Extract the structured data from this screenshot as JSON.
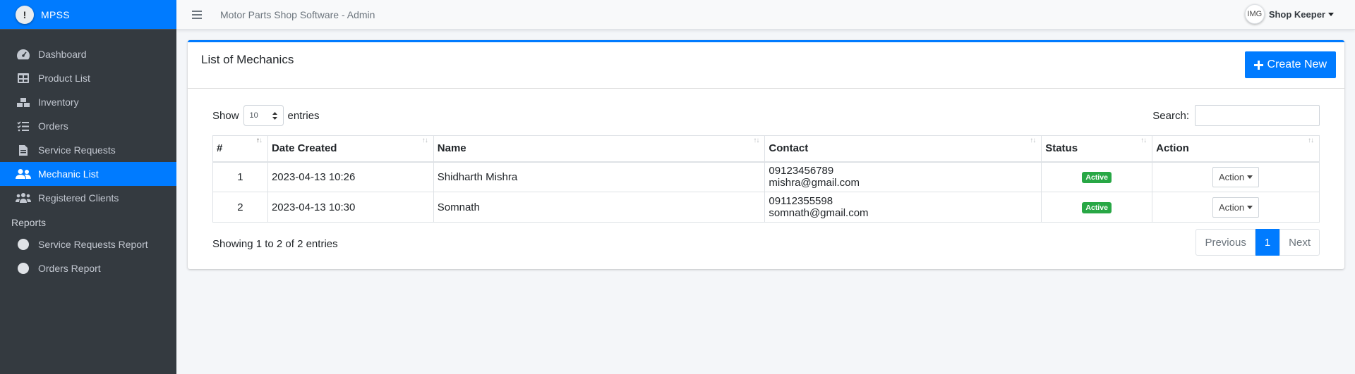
{
  "brand": {
    "logo_text": "!",
    "name": "MPSS"
  },
  "topbar": {
    "title": "Motor Parts Shop Software - Admin",
    "user": "Shop Keeper",
    "avatar_text": "IMG"
  },
  "sidebar": {
    "items": [
      {
        "label": "Dashboard",
        "icon": "tachometer-icon"
      },
      {
        "label": "Product List",
        "icon": "table-grid-icon"
      },
      {
        "label": "Inventory",
        "icon": "boxes-icon"
      },
      {
        "label": "Orders",
        "icon": "list-check-icon"
      },
      {
        "label": "Service Requests",
        "icon": "file-icon"
      },
      {
        "label": "Mechanic List",
        "icon": "user-friends-icon",
        "active": true
      },
      {
        "label": "Registered Clients",
        "icon": "users-icon"
      }
    ],
    "reports_header": "Reports",
    "reports": [
      {
        "label": "Service Requests Report",
        "icon": "circle-icon"
      },
      {
        "label": "Orders Report",
        "icon": "circle-icon"
      }
    ]
  },
  "card": {
    "title": "List of Mechanics",
    "create_label": "Create New",
    "show_label": "Show",
    "entries_value": "10",
    "entries_label": "entries",
    "search_label": "Search:"
  },
  "table": {
    "columns": [
      "#",
      "Date Created",
      "Name",
      "Contact",
      "Status",
      "Action"
    ],
    "rows": [
      {
        "num": "1",
        "date": "2023-04-13 10:26",
        "name": "Shidharth Mishra",
        "phone": "09123456789",
        "email": "mishra@gmail.com",
        "status": "Active",
        "action": "Action"
      },
      {
        "num": "2",
        "date": "2023-04-13 10:30",
        "name": "Somnath",
        "phone": "09112355598",
        "email": "somnath@gmail.com",
        "status": "Active",
        "action": "Action"
      }
    ]
  },
  "footer": {
    "info": "Showing 1 to 2 of 2 entries",
    "previous": "Previous",
    "page": "1",
    "next": "Next"
  },
  "colors": {
    "primary": "#007bff",
    "sidebar": "#343a40",
    "success": "#28a745"
  }
}
